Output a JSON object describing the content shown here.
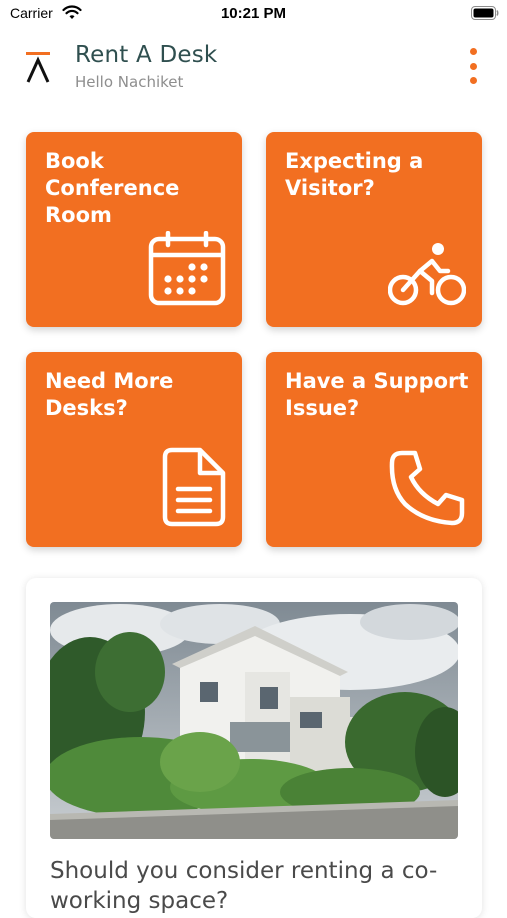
{
  "status_bar": {
    "carrier": "Carrier",
    "time": "10:21 PM"
  },
  "header": {
    "title": "Rent A Desk",
    "greeting": "Hello Nachiket",
    "logo_icon": "lambda-logo-icon",
    "menu_icon": "vertical-ellipsis-icon"
  },
  "tiles": [
    {
      "label": "Book Conference Room",
      "icon": "calendar-icon"
    },
    {
      "label": "Expecting a Visitor?",
      "icon": "bicycle-icon"
    },
    {
      "label": "Need More Desks?",
      "icon": "document-icon"
    },
    {
      "label": "Have a Support Issue?",
      "icon": "phone-icon"
    }
  ],
  "article": {
    "title": "Should you consider renting a co-working space?",
    "image": "house-photo"
  },
  "colors": {
    "accent": "#f26f21",
    "title": "#2f4f4f",
    "subtitle": "#8e8e8e"
  }
}
